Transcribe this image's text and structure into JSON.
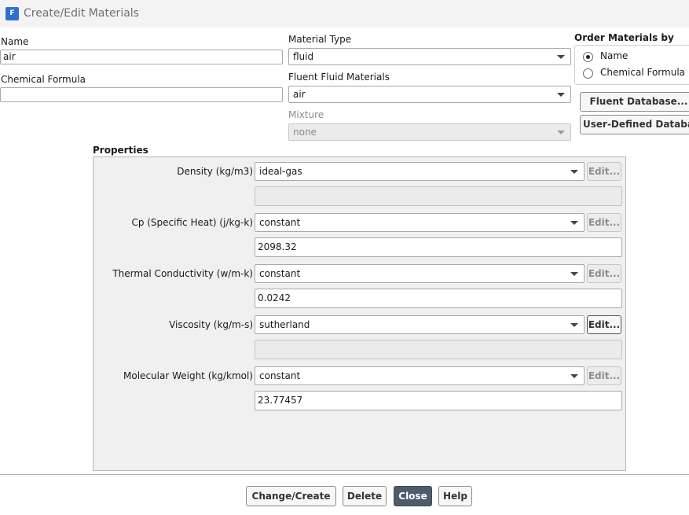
{
  "window": {
    "title": "Create/Edit Materials",
    "icon_letter": "F"
  },
  "name": {
    "label": "Name",
    "value": "air"
  },
  "chemical_formula": {
    "label": "Chemical Formula",
    "value": ""
  },
  "material_type": {
    "label": "Material Type",
    "value": "fluid"
  },
  "fluent_fluid_materials": {
    "label": "Fluent Fluid Materials",
    "value": "air"
  },
  "mixture": {
    "label": "Mixture",
    "value": "none",
    "enabled": false
  },
  "order_by": {
    "label": "Order Materials by",
    "options": [
      {
        "label": "Name",
        "selected": true
      },
      {
        "label": "Chemical Formula",
        "selected": false
      }
    ]
  },
  "database_buttons": {
    "fluent": "Fluent Database...",
    "user_defined": "User-Defined Database..."
  },
  "properties": {
    "heading": "Properties",
    "edit_label": "Edit...",
    "rows": [
      {
        "label": "Density (kg/m3)",
        "method": "ideal-gas",
        "value": "",
        "edit_enabled": false
      },
      {
        "label": "Cp (Specific Heat) (j/kg-k)",
        "method": "constant",
        "value": "2098.32",
        "edit_enabled": false
      },
      {
        "label": "Thermal Conductivity (w/m-k)",
        "method": "constant",
        "value": "0.0242",
        "edit_enabled": false
      },
      {
        "label": "Viscosity (kg/m-s)",
        "method": "sutherland",
        "value": "",
        "edit_enabled": true
      },
      {
        "label": "Molecular Weight (kg/kmol)",
        "method": "constant",
        "value": "23.77457",
        "edit_enabled": false
      }
    ]
  },
  "footer": {
    "change_create": "Change/Create",
    "delete": "Delete",
    "close": "Close",
    "help": "Help"
  },
  "colors": {
    "primary_button": "#4e5b6b",
    "app_icon": "#2f6fd1"
  }
}
